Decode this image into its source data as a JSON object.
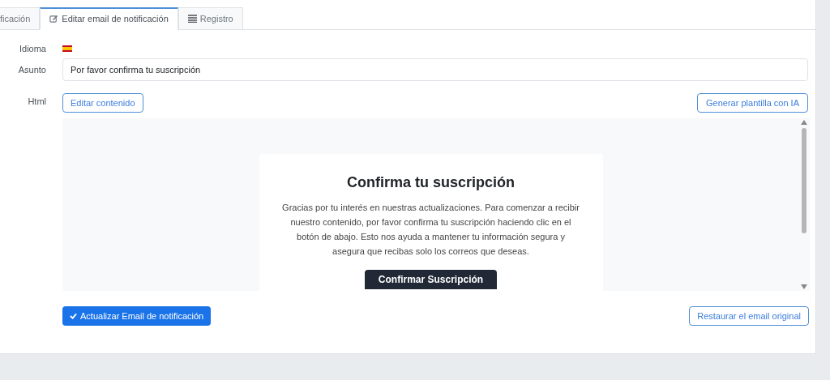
{
  "tabs": [
    {
      "label": "ficación",
      "kind": "plain",
      "selected": false
    },
    {
      "label": "Editar email de notificación",
      "kind": "edit",
      "selected": true
    },
    {
      "label": "Registro",
      "kind": "log",
      "selected": false
    }
  ],
  "form": {
    "language_label": "Idioma",
    "subject_label": "Asunto",
    "subject_value": "Por favor confirma tu suscripción",
    "html_label": "Html",
    "edit_button": "Editar contenido",
    "generate_button": "Generar plantilla con IA"
  },
  "preview": {
    "heading": "Confirma tu suscripción",
    "body": "Gracias por tu interés en nuestras actualizaciones. Para comenzar a recibir nuestro contenido, por favor confirma tu suscripción haciendo clic en el botón de abajo. Esto nos ayuda a mantener tu información segura y asegura que recibas solo los correos que deseas.",
    "button": "Confirmar Suscripción"
  },
  "actions": {
    "save_button": "Actualizar Email de notificación",
    "restore_button": "Restaurar el email original"
  }
}
